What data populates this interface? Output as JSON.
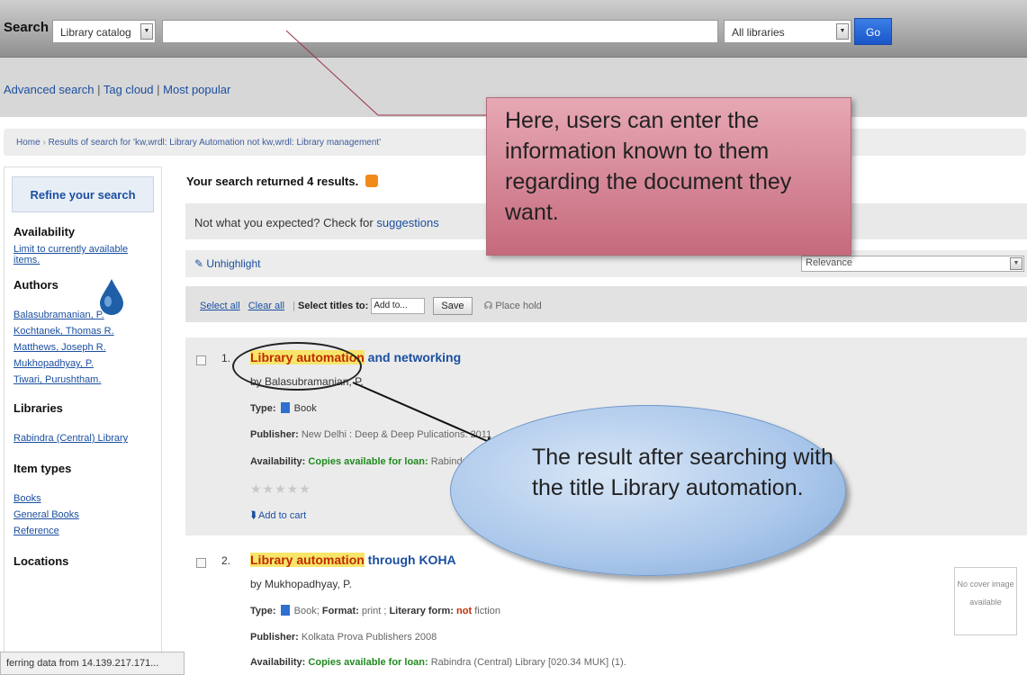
{
  "topbar": {
    "search_label": "Search",
    "scope_value": "Library catalog",
    "search_value": "",
    "library_value": "All libraries",
    "go_label": "Go"
  },
  "links": {
    "advanced": "Advanced search",
    "tag_cloud": "Tag cloud",
    "most_popular": "Most popular",
    "sep": "|"
  },
  "breadcrumb": {
    "home": "Home",
    "current": "Results of search for 'kw,wrdl: Library Automation not kw,wrdl: Library management'"
  },
  "sidebar": {
    "refine_title": "Refine your search",
    "availability_head": "Availability",
    "availability_link": "Limit to currently available items.",
    "authors_head": "Authors",
    "authors": [
      "Balasubramanian, P.",
      "Kochtanek, Thomas R.",
      "Matthews, Joseph R.",
      "Mukhopadhyay, P.",
      "Tiwari, Purushtham."
    ],
    "libraries_head": "Libraries",
    "libraries": [
      "Rabindra (Central) Library"
    ],
    "itemtypes_head": "Item types",
    "itemtypes": [
      "Books",
      "General Books",
      "Reference"
    ],
    "location_head": "Locations"
  },
  "results": {
    "summary": "Your search returned 4 results.",
    "expected_text": "Not what you expected? Check for",
    "suggestions": "suggestions",
    "unhighlight": "Unhighlight",
    "sort_value": "Relevance",
    "select_all": "Select all",
    "clear_all": "Clear all",
    "select_titles": "Select titles to:",
    "add_to": "Add to...",
    "save": "Save",
    "place_hold": "Place hold"
  },
  "result1": {
    "num": "1.",
    "title_hl": "Library automation",
    "title_rest": " and networking",
    "author": "by Balasubramanian, P.",
    "type_label": "Type:",
    "type_value": "Book",
    "publisher_label": "Publisher:",
    "publisher_value": "New Delhi : Deep & Deep Pulications. 2011",
    "availability_label": "Availability:",
    "availability_value": "Copies available for loan:",
    "availability_lib": "Rabindra (Cent",
    "stars": "★★★★★",
    "cart": "Add to cart"
  },
  "result2": {
    "num": "2.",
    "title_hl": "Library automation",
    "title_rest": " through KOHA",
    "author": "by Mukhopadhyay, P.",
    "type_label": "Type:",
    "type_value": "Book;",
    "format_label": "Format:",
    "format_value": "print ;",
    "litform_label": "Literary form:",
    "litform_value1": "not",
    "litform_value2": " fiction",
    "publisher_label": "Publisher:",
    "publisher_value": "Kolkata Prova Publishers 2008",
    "availability_label": "Availability:",
    "availability_value": "Copies available for loan:",
    "availability_lib": "Rabindra (Central) Library [020.34 MUK] (1).",
    "nocover": "No cover image available"
  },
  "status": "ferring data from 14.139.217.171...",
  "annotations": {
    "top": "Here, users can enter the information known to them regarding the document they want.",
    "bottom": "The result after searching with the title Library automation."
  }
}
